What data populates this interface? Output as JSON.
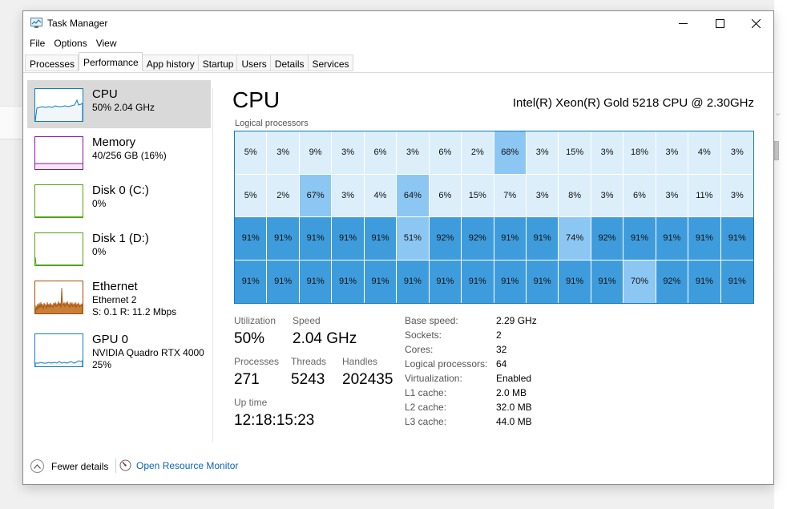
{
  "window": {
    "title": "Task Manager"
  },
  "menu": [
    "File",
    "Options",
    "View"
  ],
  "tabs": [
    {
      "label": "Processes",
      "active": false
    },
    {
      "label": "Performance",
      "active": true
    },
    {
      "label": "App history",
      "active": false
    },
    {
      "label": "Startup",
      "active": false
    },
    {
      "label": "Users",
      "active": false
    },
    {
      "label": "Details",
      "active": false
    },
    {
      "label": "Services",
      "active": false
    }
  ],
  "sidebar": {
    "items": [
      {
        "title": "CPU",
        "line1": "50%  2.04 GHz",
        "line2": "",
        "line3": "",
        "color": "#117dbb",
        "active": true
      },
      {
        "title": "Memory",
        "line1": "40/256 GB (16%)",
        "line2": "",
        "line3": "",
        "color": "#8b12ae",
        "active": false
      },
      {
        "title": "Disk 0 (C:)",
        "line1": "0%",
        "line2": "",
        "line3": "",
        "color": "#4da60c",
        "active": false
      },
      {
        "title": "Disk 1 (D:)",
        "line1": "0%",
        "line2": "",
        "line3": "",
        "color": "#4da60c",
        "active": false
      },
      {
        "title": "Ethernet",
        "line1": "Ethernet 2",
        "line2": "S: 0.1  R: 11.2 Mbps",
        "line3": "",
        "color": "#a74f01",
        "active": false
      },
      {
        "title": "GPU 0",
        "line1": "NVIDIA Quadro RTX 4000",
        "line2": "25%",
        "line3": "",
        "color": "#117dbb",
        "active": false
      }
    ]
  },
  "main": {
    "title": "CPU",
    "cpu_name": "Intel(R) Xeon(R) Gold 5218 CPU @ 2.30GHz",
    "grid_label": "Logical processors",
    "processors": [
      5,
      3,
      9,
      3,
      6,
      3,
      6,
      2,
      68,
      3,
      15,
      3,
      18,
      3,
      4,
      3,
      5,
      2,
      67,
      3,
      4,
      64,
      6,
      15,
      7,
      3,
      8,
      3,
      6,
      3,
      11,
      3,
      91,
      91,
      91,
      91,
      91,
      51,
      92,
      92,
      91,
      91,
      74,
      92,
      91,
      91,
      91,
      91,
      91,
      91,
      91,
      91,
      91,
      91,
      91,
      91,
      91,
      91,
      91,
      91,
      70,
      92,
      91,
      91
    ],
    "stats": {
      "utilization_label": "Utilization",
      "utilization": "50%",
      "speed_label": "Speed",
      "speed": "2.04 GHz",
      "processes_label": "Processes",
      "processes": "271",
      "threads_label": "Threads",
      "threads": "5243",
      "handles_label": "Handles",
      "handles": "202435",
      "uptime_label": "Up time",
      "uptime": "12:18:15:23"
    },
    "info": [
      {
        "label": "Base speed:",
        "value": "2.29 GHz"
      },
      {
        "label": "Sockets:",
        "value": "2"
      },
      {
        "label": "Cores:",
        "value": "32"
      },
      {
        "label": "Logical processors:",
        "value": "64"
      },
      {
        "label": "Virtualization:",
        "value": "Enabled"
      },
      {
        "label": "L1 cache:",
        "value": "2.0 MB"
      },
      {
        "label": "L2 cache:",
        "value": "32.0 MB"
      },
      {
        "label": "L3 cache:",
        "value": "44.0 MB"
      }
    ]
  },
  "footer": {
    "fewer_details": "Fewer details",
    "resource_monitor": "Open Resource Monitor"
  },
  "colors": {
    "accent": "#117dbb",
    "cell_low": "#dbeefa",
    "cell_mid": "#8cc6f2",
    "cell_high": "#3e9cdc",
    "link": "#0a64b6"
  }
}
